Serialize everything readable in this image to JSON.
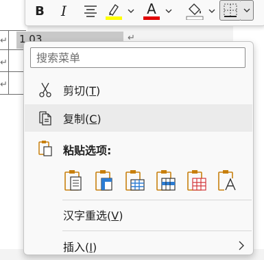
{
  "toolbar": {
    "bold_label": "B",
    "italic_label": "I",
    "highlight_color": "#ffff00",
    "font_color": "#e00000",
    "font_color_letter": "A",
    "buttons": [
      "bold-icon",
      "italic-icon",
      "align-icon",
      "highlight-icon",
      "font-color-icon",
      "shading-icon",
      "borders-icon"
    ]
  },
  "document": {
    "cell_value": "1.03"
  },
  "menu": {
    "search_placeholder": "搜索菜单",
    "items": {
      "cut": {
        "label": "剪切(",
        "key": "T",
        "tail": ")",
        "icon": "scissors-icon"
      },
      "copy": {
        "label": "复制(",
        "key": "C",
        "tail": ")",
        "icon": "copy-icon"
      },
      "paste_options": {
        "label": "粘贴选项:",
        "icon": "paste-icon"
      },
      "reselect": {
        "label": "汉字重选(",
        "key": "V",
        "tail": ")"
      },
      "insert": {
        "label": "插入(",
        "key": "I",
        "tail": ")"
      }
    },
    "paste_buttons": [
      "paste-keep-source-icon",
      "paste-merge-table-icon",
      "paste-nest-table-icon",
      "paste-insert-rows-icon",
      "paste-overwrite-cells-icon",
      "paste-text-only-icon"
    ],
    "accent": "#c77f0c"
  }
}
